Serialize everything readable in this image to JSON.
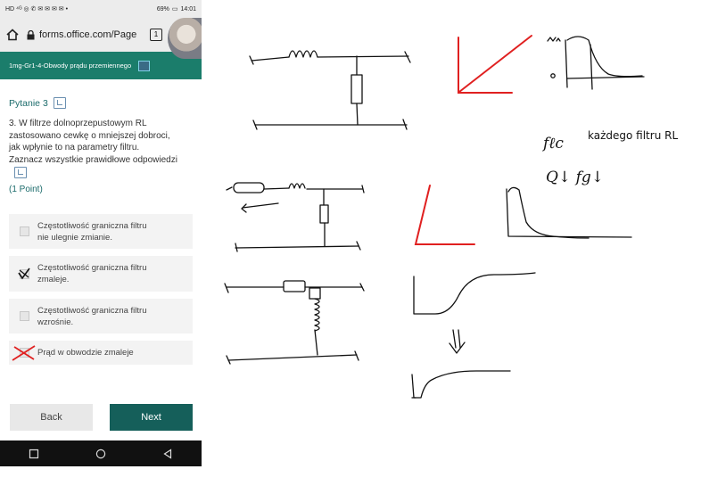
{
  "status": {
    "left_icons": "HD ⁴ᴳ ◎ ✆ ✉ ✉ ✉ ✉ •",
    "battery": "69%",
    "time": "14:01"
  },
  "browser": {
    "url": "forms.office.com/Page",
    "tab_count": "1"
  },
  "form": {
    "title": "1mg-Gr1-4-Obwody prądu przemiennego"
  },
  "question": {
    "heading": "Pytanie 3",
    "text_lines": [
      "3. W filtrze dolnoprzepustowym RL",
      "zastosowano cewkę o mniejszej dobroci,",
      "jak wpłynie to na parametry filtru.",
      "Zaznacz wszystkie prawidłowe odpowiedzi"
    ],
    "points": "(1 Point)",
    "options": [
      {
        "label_lines": [
          "Częstotliwość graniczna filtru",
          "nie ulegnie zmianie."
        ],
        "mark": "none"
      },
      {
        "label_lines": [
          "Częstotliwość graniczna filtru",
          "zmaleje."
        ],
        "mark": "check"
      },
      {
        "label_lines": [
          "Częstotliwość graniczna filtru",
          "wzrośnie."
        ],
        "mark": "none"
      },
      {
        "label_lines": [
          "Prąd w obwodzie zmaleje"
        ],
        "mark": "cross"
      }
    ]
  },
  "buttons": {
    "back": "Back",
    "next": "Next"
  },
  "whiteboard": {
    "typed_note": "każdego filtru RL",
    "handwritten": [
      "fℓc",
      "Q↓ fg↓"
    ]
  },
  "colors": {
    "accent": "#1b7d6b",
    "next_button": "#155f5a",
    "pen_red": "#e02020",
    "pen_black": "#111111"
  }
}
